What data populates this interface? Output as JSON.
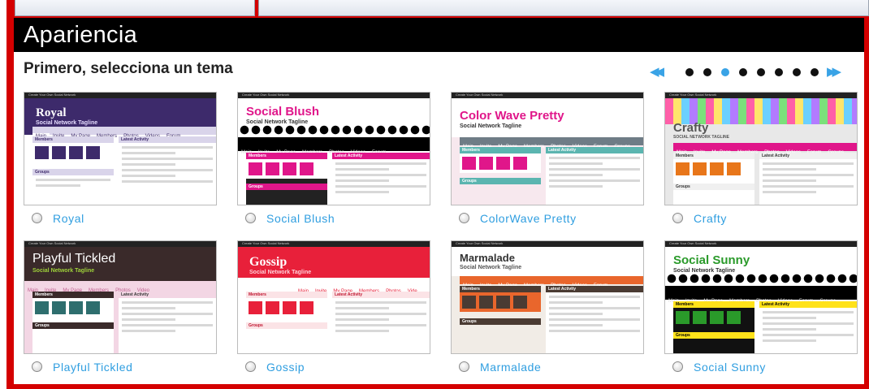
{
  "window": {
    "title": "Apariencia"
  },
  "main": {
    "heading": "Primero, selecciona un tema",
    "pager": {
      "prev_icon": "double-left-arrow-icon",
      "next_icon": "double-right-arrow-icon",
      "page_count": 8,
      "current_page": 3
    },
    "themes": [
      {
        "label": "Royal",
        "preview": {
          "top": "Create Your Own Social Network",
          "name": "Royal",
          "tagline": "Social Network Tagline",
          "nav": [
            "Main",
            "Invite",
            "My Page",
            "Members",
            "Photos",
            "Videos",
            "Forum"
          ]
        }
      },
      {
        "label": "Social Blush",
        "preview": {
          "top": "Create Your Own Social Network",
          "name": "Social Blush",
          "tagline": "Social Network Tagline",
          "nav": [
            "Main",
            "Invite",
            "My Page",
            "Members",
            "Photos",
            "Videos",
            "Forum"
          ]
        }
      },
      {
        "label": "ColorWave Pretty",
        "preview": {
          "top": "Create Your Own Social Network",
          "name": "Color Wave Pretty",
          "tagline": "Social Network Tagline",
          "nav": [
            "Main",
            "Invite",
            "My Page",
            "Members",
            "Photos",
            "Videos",
            "Forum",
            "Groups"
          ]
        }
      },
      {
        "label": "Crafty",
        "preview": {
          "top": "Create Your Own Social Network",
          "name": "Crafty",
          "tagline": "SOCIAL NETWORK TAGLINE",
          "nav": [
            "Main",
            "Invite",
            "My Page",
            "Members",
            "Photos",
            "Videos",
            "Forum",
            "Groups"
          ]
        }
      },
      {
        "label": "Playful Tickled",
        "preview": {
          "top": "Create Your Own Social Network",
          "name": "Playful Tickled",
          "tagline": "Social Network Tagline",
          "nav": [
            "Main",
            "Invite",
            "My Page",
            "Members",
            "Photos",
            "Video"
          ]
        }
      },
      {
        "label": "Gossip",
        "preview": {
          "top": "Create Your Own Social Network",
          "name": "Gossip",
          "tagline": "Social Network Tagline",
          "nav": [
            "Main",
            "Invite",
            "My Page",
            "Members",
            "Photos",
            "Vide"
          ]
        }
      },
      {
        "label": "Marmalade",
        "preview": {
          "top": "Create Your Own Social Network",
          "name": "Marmalade",
          "tagline": "Social Network Tagline",
          "nav": [
            "Main",
            "Invite",
            "My Page",
            "Members",
            "Photos",
            "Videos",
            "Forum"
          ]
        }
      },
      {
        "label": "Social Sunny",
        "preview": {
          "top": "Create Your Own Social Network",
          "name": "Social Sunny",
          "tagline": "Social Network Tagline",
          "nav": [
            "Main",
            "Invite",
            "My Page",
            "Members",
            "Photos",
            "Videos",
            "Forum",
            "Groups"
          ]
        }
      }
    ],
    "preview_labels": {
      "members": "Members",
      "activity": "Latest Activity",
      "groups": "Groups"
    }
  },
  "colors": {
    "frame": "#d40000",
    "title_bar": "#000000",
    "link": "#2f9ee0",
    "pager_active": "#39a3e6"
  }
}
